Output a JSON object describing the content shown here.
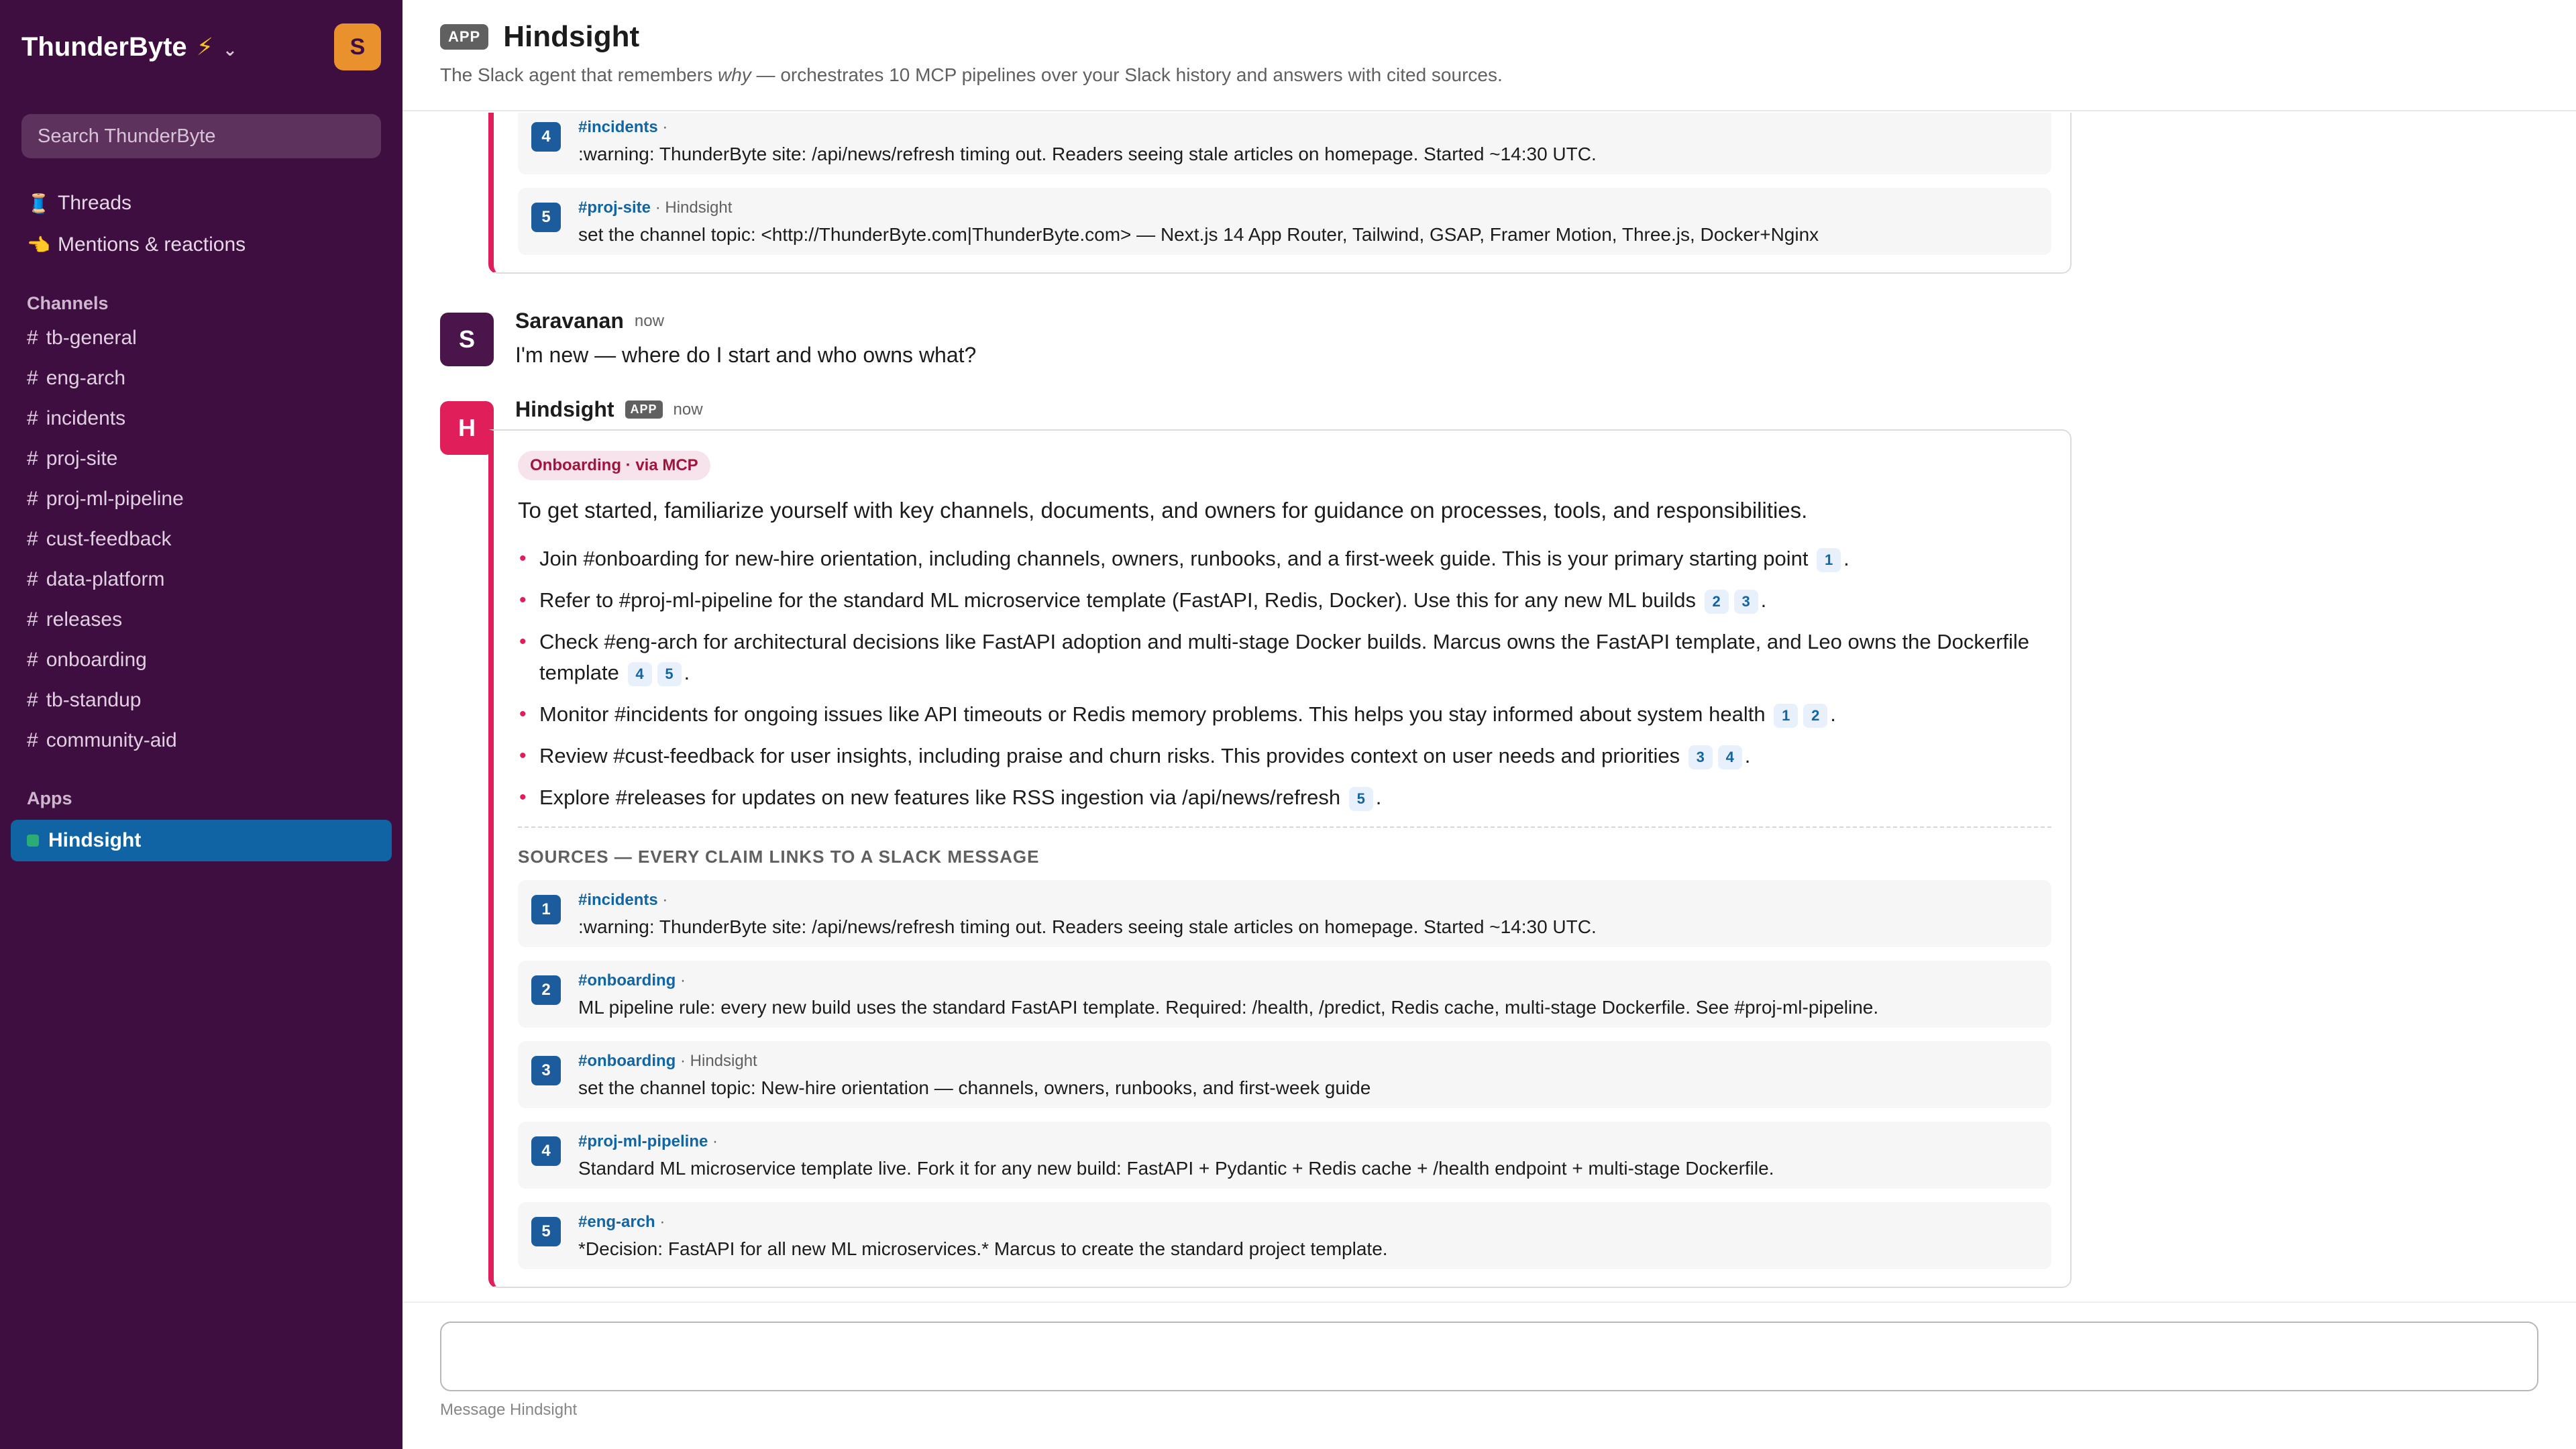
{
  "workspace": {
    "name": "ThunderByte",
    "avatar_letter": "S"
  },
  "search": {
    "placeholder": "Search ThunderByte"
  },
  "nav": {
    "threads": "Threads",
    "mentions": "Mentions & reactions"
  },
  "channels_label": "Channels",
  "channels": [
    "tb-general",
    "eng-arch",
    "incidents",
    "proj-site",
    "proj-ml-pipeline",
    "cust-feedback",
    "data-platform",
    "releases",
    "onboarding",
    "tb-standup",
    "community-aid"
  ],
  "apps_label": "Apps",
  "apps": [
    "Hindsight"
  ],
  "header": {
    "badge": "APP",
    "title": "Hindsight",
    "subtitle_a": "The Slack agent that remembers ",
    "subtitle_em": "why",
    "subtitle_b": " — orchestrates 10 MCP pipelines over your Slack history and answers with cited sources."
  },
  "prev_sources": [
    {
      "num": "4",
      "channel": "#incidents",
      "meta": " ·",
      "text": ":warning: ThunderByte site: /api/news/refresh timing out. Readers seeing stale articles on homepage. Started ~14:30 UTC."
    },
    {
      "num": "5",
      "channel": "#proj-site",
      "meta": " · Hindsight",
      "text": "set the channel topic: <http://ThunderByte.com|ThunderByte.com> — Next.js 14 App Router, Tailwind, GSAP, Framer Motion, Three.js, Docker+Nginx"
    }
  ],
  "user_msg": {
    "avatar": "S",
    "author": "Saravanan",
    "time": "now",
    "text": "I'm new — where do I start and who owns what?"
  },
  "bot_msg": {
    "avatar": "H",
    "author": "Hindsight",
    "badge": "APP",
    "time": "now",
    "route": "Onboarding · via MCP",
    "intro": "To get started, familiarize yourself with key channels, documents, and owners for guidance on processes, tools, and responsibilities.",
    "bullets": [
      {
        "text": "Join #onboarding for new-hire orientation, including channels, owners, runbooks, and a first-week guide. This is your primary starting point",
        "cites": [
          "1"
        ]
      },
      {
        "text": "Refer to #proj-ml-pipeline for the standard ML microservice template (FastAPI, Redis, Docker). Use this for any new ML builds",
        "cites": [
          "2",
          "3"
        ]
      },
      {
        "text": "Check #eng-arch for architectural decisions like FastAPI adoption and multi-stage Docker builds. Marcus owns the FastAPI template, and Leo owns the Dockerfile template",
        "cites": [
          "4",
          "5"
        ]
      },
      {
        "text": "Monitor #incidents for ongoing issues like API timeouts or Redis memory problems. This helps you stay informed about system health",
        "cites": [
          "1",
          "2"
        ]
      },
      {
        "text": "Review #cust-feedback for user insights, including praise and churn risks. This provides context on user needs and priorities",
        "cites": [
          "3",
          "4"
        ]
      },
      {
        "text": "Explore #releases for updates on new features like RSS ingestion via /api/news/refresh",
        "cites": [
          "5"
        ]
      }
    ],
    "sources_label": "SOURCES — EVERY CLAIM LINKS TO A SLACK MESSAGE",
    "sources": [
      {
        "num": "1",
        "channel": "#incidents",
        "meta": " ·",
        "text": ":warning: ThunderByte site: /api/news/refresh timing out. Readers seeing stale articles on homepage. Started ~14:30 UTC."
      },
      {
        "num": "2",
        "channel": "#onboarding",
        "meta": " ·",
        "text": "ML pipeline rule: every new build uses the standard FastAPI template. Required: /health, /predict, Redis cache, multi-stage Dockerfile. See #proj-ml-pipeline."
      },
      {
        "num": "3",
        "channel": "#onboarding",
        "meta": " · Hindsight",
        "text": "set the channel topic: New-hire orientation — channels, owners, runbooks, and first-week guide"
      },
      {
        "num": "4",
        "channel": "#proj-ml-pipeline",
        "meta": " ·",
        "text": "Standard ML microservice template live. Fork it for any new build: FastAPI + Pydantic + Redis cache + /health endpoint + multi-stage Dockerfile."
      },
      {
        "num": "5",
        "channel": "#eng-arch",
        "meta": " ·",
        "text": "*Decision: FastAPI for all new ML microservices.* Marcus to create the standard project template."
      }
    ]
  },
  "composer": {
    "placeholder": "",
    "hint": "Message Hindsight"
  },
  "colors": {
    "sidebar": "#3f0e40",
    "accent": "#e01e5a",
    "active": "#1164a3",
    "citation": "#1d5c9c"
  },
  "icons": {
    "threads": "thread-spool-icon",
    "mentions": "mentions-hand-icon",
    "workspace_bolt": "lightning-icon",
    "app_dot": "app-status-icon"
  }
}
